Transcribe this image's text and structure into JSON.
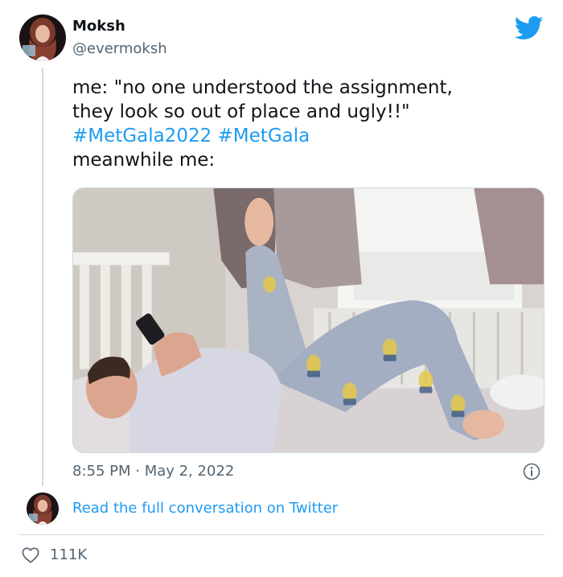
{
  "author": {
    "name": "Moksh",
    "handle": "@evermoksh",
    "avatar_icon": "profile-avatar"
  },
  "brand": {
    "icon": "twitter-bird-icon",
    "color": "#1d9bf0"
  },
  "tweet": {
    "line1": "me: \"no one understood the assignment,",
    "line2": "they look so out of place and ugly!!\"",
    "hashtag1": "#MetGala2022",
    "hashtag2": "#MetGala",
    "line4": "meanwhile me:",
    "media_description": "photo-person-lying-on-bed"
  },
  "meta": {
    "time": "8:55 PM",
    "separator": " · ",
    "date": "May 2, 2022"
  },
  "read_more": "Read the full conversation on Twitter",
  "stats": {
    "likes": "111K",
    "like_icon": "heart-icon"
  },
  "colors": {
    "link": "#1d9bf0",
    "secondary_text": "#536471",
    "primary_text": "#0f1419",
    "divider": "#cfd9de"
  }
}
